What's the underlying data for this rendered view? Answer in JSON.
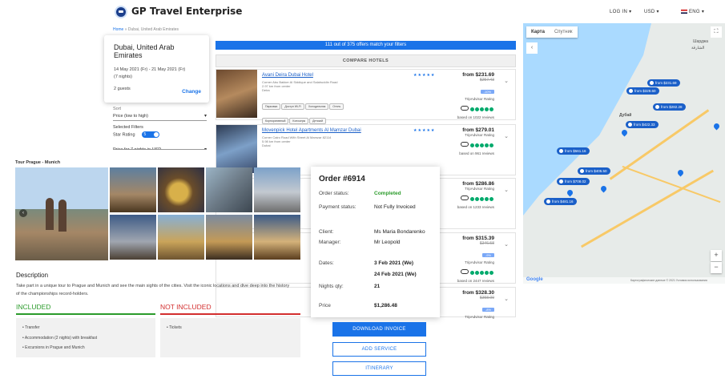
{
  "header": {
    "brand": "GP Travel Enterprise",
    "login": "LOG IN",
    "currency": "USD",
    "language": "ENG"
  },
  "breadcrumb": {
    "home": "Home",
    "sep": "»",
    "current": "Dubai, United Arab Emirates"
  },
  "search": {
    "destination": "Dubai, United Arab Emirates",
    "dates": "14 May 2021 (Fr) - 21 May 2021 (Fr)",
    "nights": "(7 nights)",
    "guests": "2 guests",
    "change": "Change"
  },
  "filters": {
    "sort_label": "Sort",
    "sort_value": "Price (low to high)",
    "selected_label": "Selected Filters",
    "star_label": "Star Rating",
    "star_value": "5",
    "price_label": "Price for 7 nights in USD"
  },
  "results": {
    "banner": "111 out of 375 offers match your filters",
    "compare": "COMPARE HOTELS",
    "rating_label": "TripAdvisor Rating"
  },
  "hotels": [
    {
      "name": "Avani Deira Dubai Hotel",
      "addr1": "Corner Abu Bakker Al Siddique and Salahuddin Road",
      "addr2": "2.97 km from center",
      "addr3": "Deira",
      "price": "from $231.69",
      "old": "$257.43",
      "badge": "-10%",
      "reviews": "based on 1022 reviews",
      "tags": [
        "Парковка",
        "Доступ Wi-Fi",
        "Холодильник",
        "Отель",
        "Корпоративный",
        "Консьерж",
        "Детский"
      ]
    },
    {
      "name": "Movenpick Hotel Apartments Al Mamzar Dubai",
      "addr1": "Corner Cairo Road With Street Al Mamzar 82114",
      "addr2": "5.98 km from center",
      "addr3": "Dubai",
      "price": "from $279.01",
      "old": "",
      "badge": "",
      "reviews": "based on 961 reviews",
      "tags": []
    },
    {
      "price": "from $286.86",
      "old": "",
      "badge": "",
      "reviews": "based on 1233 reviews"
    },
    {
      "price": "from $315.39",
      "old": "$346.58",
      "badge": "-9%",
      "reviews": "based on 2447 reviews"
    },
    {
      "price": "from $328.30",
      "old": "$358.09",
      "badge": "-8%",
      "reviews": ""
    }
  ],
  "tour": {
    "title": "Tour Prague - Munich",
    "desc_heading": "Description",
    "desc": "Take part in a unique tour to Prague and Munich and see the main sights of the cities. Visit the iconic locations and dive deep into the history of the championships record-holders.",
    "included_h": "INCLUDED",
    "not_included_h": "NOT INCLUDED",
    "included": [
      "Transfer",
      "Accommodation (2 nights) with breakfast",
      "Excursions in Prague and Munich"
    ],
    "not_included": [
      "Tickets"
    ]
  },
  "order": {
    "title": "Order  #6914",
    "status_label": "Order  status:",
    "status": "Completed",
    "payment_label": "Payment  status:",
    "payment": "Not Fully Invoiced",
    "client_label": "Client:",
    "client": "Ms Maria Bondarenko",
    "manager_label": "Manager:",
    "manager": "Mr Leopold",
    "dates_label": "Dates:",
    "date1": "3 Feb 2021 (We)",
    "date2": "24 Feb 2021 (We)",
    "nights_label": "Nights qty:",
    "nights": "21",
    "price_label": "Price",
    "price": "$1,286.48"
  },
  "actions": {
    "download": "DOWNLOAD INVOICE",
    "add": "ADD SERVICE",
    "itinerary": "ITINERARY"
  },
  "map": {
    "tab_map": "Карта",
    "tab_sat": "Спутник",
    "city_ar": "الشارقة",
    "city": "Шарджа",
    "dubai": "Дубай",
    "footer": "Картографические данные © 2021   Условия использования",
    "markers": [
      "from $231.69",
      "from $329.60",
      "from $282.28",
      "from $422.33",
      "from $561.16",
      "from $405.50",
      "from $708.02",
      "from $481.16"
    ]
  },
  "colors": {
    "accent": "#1a73e8",
    "included": "#2b9b2b",
    "excluded": "#d32f2f"
  }
}
